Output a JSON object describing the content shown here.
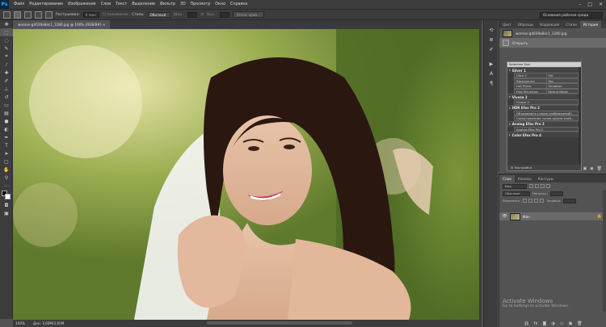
{
  "app": {
    "logo": "Ps",
    "menu": [
      "Файл",
      "Редактирование",
      "Изображение",
      "Слои",
      "Текст",
      "Выделение",
      "Фильтр",
      "3D",
      "Просмотр",
      "Окно",
      "Справка"
    ],
    "window_controls": [
      "–",
      "□",
      "✕"
    ]
  },
  "options_bar": {
    "feather_label": "Растушевка:",
    "feather_value": "0 пикс",
    "antialias_label": "Сглаживание",
    "style_label": "Стиль:",
    "style_value": "Обычный",
    "width_label": "Шир.:",
    "height_label": "Выс.:",
    "refine_button": "Уточн. край...",
    "workspace": "Основная рабочая среда"
  },
  "document": {
    "tab_title": "woman-g4039a8ec1_1280.jpg @ 100% (RGB/8#)",
    "zoom": "100%",
    "doc_info": "Док: 3,60M/3,60M"
  },
  "panel_top": {
    "tabs": [
      "Цвет",
      "Образцы",
      "Коррекция",
      "Стили",
      "История"
    ],
    "active_tab": "История",
    "history": [
      {
        "label": "woman-g4039a8ec1_1280.jpg",
        "type": "snapshot"
      },
      {
        "label": "Открыть",
        "type": "step"
      }
    ]
  },
  "nik": {
    "title": "Selective Tool",
    "groups": [
      {
        "name": "Silver 1",
        "items": [
          [
            "Ultra 2",
            "Slit"
          ],
          [
            "Background",
            "Sky"
          ],
          [
            "Hot Pixels",
            "Shadows"
          ],
          [
            "Fine Structure",
            "Strong Noise"
          ]
        ]
      },
      {
        "name": "Viveza 2",
        "items": [
          [
            "Viveza 2"
          ]
        ]
      },
      {
        "name": "HDR Efex Pro 2",
        "items": [
          [
            "Объединить (серия изображений)"
          ],
          [
            "Сопоставление тонов одним изоб..."
          ]
        ]
      },
      {
        "name": "Analog Efex Pro 2",
        "items": [
          [
            "Analog Efex Pro 2"
          ]
        ]
      },
      {
        "name": "Color Efex Pro 4",
        "items": []
      }
    ],
    "footer": "Настройки"
  },
  "layers_panel": {
    "tabs": [
      "Слои",
      "Каналы",
      "Контуры"
    ],
    "active_tab": "Слои",
    "search_placeholder": "Вид",
    "blend_mode": "Обычные",
    "opacity_label": "Непрозр.:",
    "lock_label": "Закрепить:",
    "fill_label": "Заливка:",
    "layer_name": "Фон"
  },
  "activation": {
    "title": "Activate Windows",
    "subtitle": "Go to Settings to activate Windows."
  }
}
